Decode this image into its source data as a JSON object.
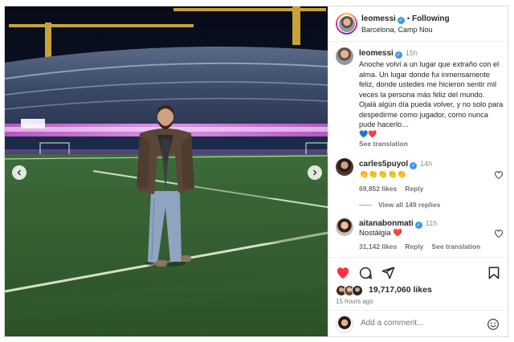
{
  "post": {
    "username": "leomessi",
    "following_label": "Following",
    "location": "Barcelona, Camp Nou",
    "verified_mark": "✓"
  },
  "caption": {
    "username": "leomessi",
    "time": "15h",
    "text": "Anoche volví a un lugar que extraño con el alma. Un lugar donde fui inmensamente feliz, donde ustedes me hicieron sentir mil veces la persona más feliz del mundo. Ojalá algún día pueda volver, y no solo para despedirme como jugador, como nunca pude hacerlo…",
    "hearts": "💙❤️",
    "see_translation": "See translation"
  },
  "comments": [
    {
      "username": "carles5puyol",
      "time": "14h",
      "text": "👏👏👏👏👏",
      "likes": "69,852 likes",
      "reply": "Reply"
    },
    {
      "username": "aitanabonmati",
      "time": "11h",
      "text": "Nostàlgia ❤️",
      "likes": "31,142 likes",
      "reply": "Reply",
      "see_translation": "See translation"
    }
  ],
  "view_replies": "View all 149 replies",
  "likes_count": "19,717,060 likes",
  "post_time": "15 hours ago",
  "add_comment_placeholder": "Add a comment...",
  "icons": {
    "like": "heart-filled-icon",
    "comment": "comment-icon",
    "share": "send-icon",
    "save": "bookmark-icon",
    "emoji": "emoji-icon",
    "prev": "chevron-left-icon",
    "next": "chevron-right-icon"
  },
  "colors": {
    "like_red": "#ff3040",
    "verified_blue": "#3897f0",
    "muted": "#737373"
  }
}
